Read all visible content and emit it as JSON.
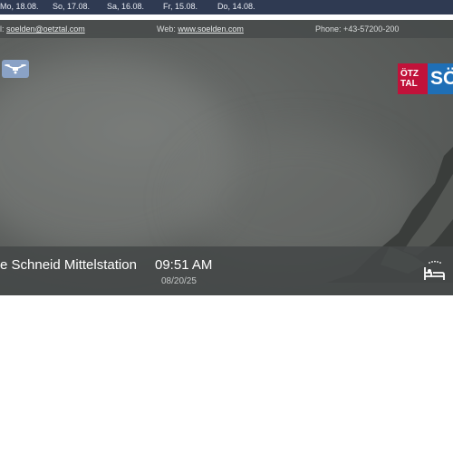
{
  "archive_dates": [
    "Mo, 18.08.",
    "So, 17.08.",
    "Sa, 16.08.",
    "Fr, 15.08.",
    "Do, 14.08."
  ],
  "info_bar": {
    "email_prefix": "l: ",
    "email": "soelden@oetztal.com",
    "web_prefix": "Web: ",
    "web": "www.soelden.com",
    "phone": "Phone: +43-57200-200"
  },
  "icons": {
    "drone": "drone-icon",
    "hotel": "hotel-bed-icon"
  },
  "logo": {
    "line1": "ÖTZ",
    "line2": "TAL",
    "right": "SÖ",
    "colors": {
      "red": "#c1123a",
      "blue": "#1f6fb6"
    }
  },
  "caption": {
    "station": "e Schneid Mittelstation",
    "time": "09:51 AM",
    "date": "08/20/25"
  }
}
